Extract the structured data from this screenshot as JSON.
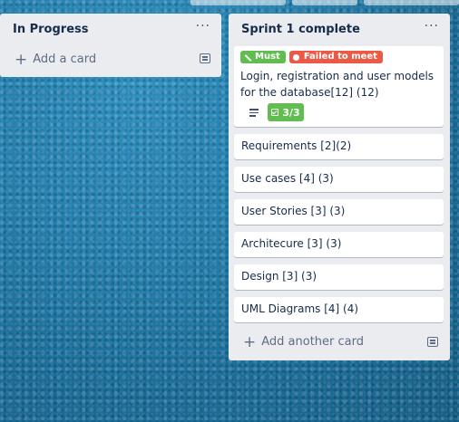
{
  "lists": {
    "in_progress": {
      "title": "In Progress",
      "menu_glyph": "···",
      "add_label": "Add a card"
    },
    "sprint": {
      "title": "Sprint 1 complete",
      "menu_glyph": "···",
      "add_label": "Add another card",
      "featured_card": {
        "labels": [
          {
            "text": "Must",
            "color": "#61bd4f",
            "icon": "flag-icon"
          },
          {
            "text": "Failed to meet",
            "color": "#eb5a46",
            "icon": "dot-icon"
          }
        ],
        "title": "Login, registration and user models for the database[12] (12)",
        "checklist": "3/3",
        "has_description_icon": true
      },
      "cards": [
        "Requirements [2](2)",
        "Use cases [4] (3)",
        "User Stories [3] (3)",
        "Architecure [3] (3)",
        "Design [3] (3)",
        "UML Diagrams [4] (4)"
      ]
    }
  },
  "colors": {
    "list_bg": "#ebecf0",
    "card_bg": "#ffffff",
    "text": "#172b4d",
    "muted": "#5e6c84",
    "label_green": "#61bd4f",
    "label_red": "#eb5a46",
    "board_bg": "#237fae"
  }
}
